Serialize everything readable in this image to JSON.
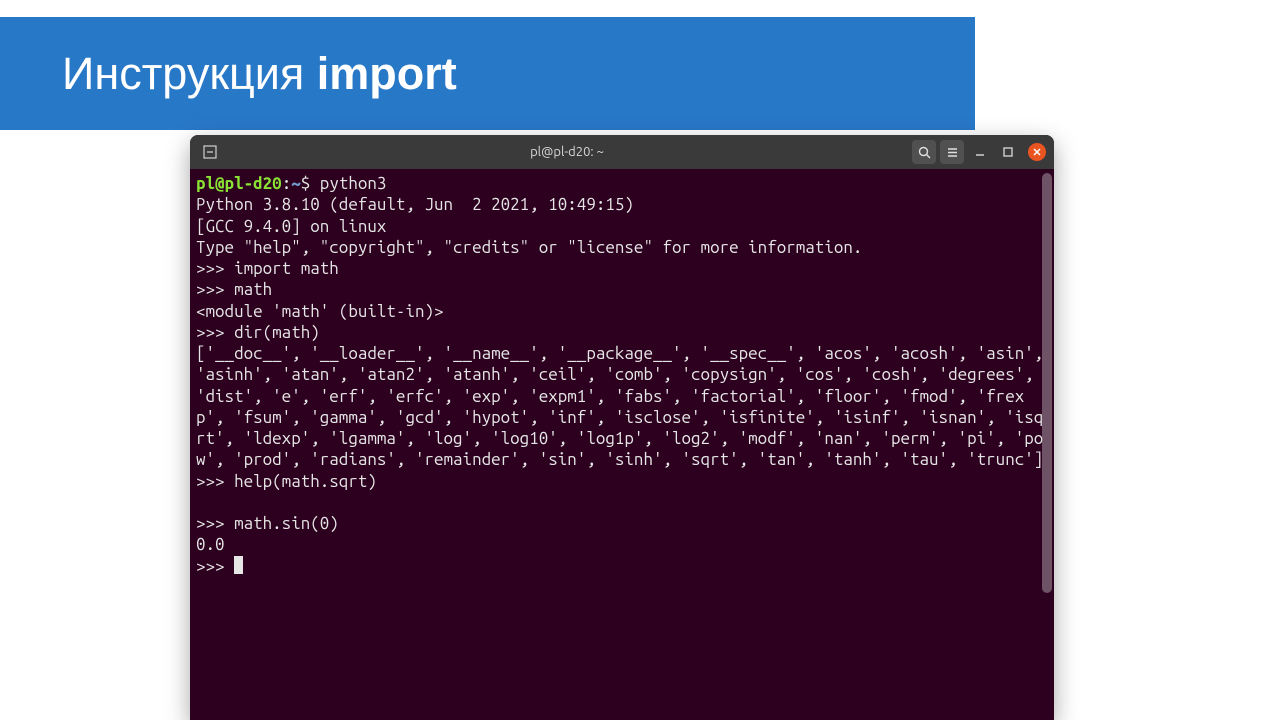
{
  "slide": {
    "title_prefix": "Инструкция ",
    "title_strong": "import"
  },
  "titlebar": {
    "title": "pl@pl-d20: ~"
  },
  "prompt": {
    "user": "pl@pl-d20",
    "sep": ":",
    "path": "~",
    "dollar": "$ "
  },
  "terminal": {
    "line_cmd": "python3",
    "line_banner1": "Python 3.8.10 (default, Jun  2 2021, 10:49:15)",
    "line_banner2": "[GCC 9.4.0] on linux",
    "line_banner3": "Type \"help\", \"copyright\", \"credits\" or \"license\" for more information.",
    "line_import": ">>> import math",
    "line_math": ">>> math",
    "line_module": "<module 'math' (built-in)>",
    "line_dir": ">>> dir(math)",
    "dir_output": "['__doc__', '__loader__', '__name__', '__package__', '__spec__', 'acos', 'acosh', 'asin', 'asinh', 'atan', 'atan2', 'atanh', 'ceil', 'comb', 'copysign', 'cos', 'cosh', 'degrees', 'dist', 'e', 'erf', 'erfc', 'exp', 'expm1', 'fabs', 'factorial', 'floor', 'fmod', 'frexp', 'fsum', 'gamma', 'gcd', 'hypot', 'inf', 'isclose', 'isfinite', 'isinf', 'isnan', 'isqrt', 'ldexp', 'lgamma', 'log', 'log10', 'log1p', 'log2', 'modf', 'nan', 'perm', 'pi', 'pow', 'prod', 'radians', 'remainder', 'sin', 'sinh', 'sqrt', 'tan', 'tanh', 'tau', 'trunc']",
    "line_help": ">>> help(math.sqrt)",
    "line_blank": "",
    "line_sin": ">>> math.sin(0)",
    "line_sin_out": "0.0",
    "line_prompt_final": ">>> "
  }
}
